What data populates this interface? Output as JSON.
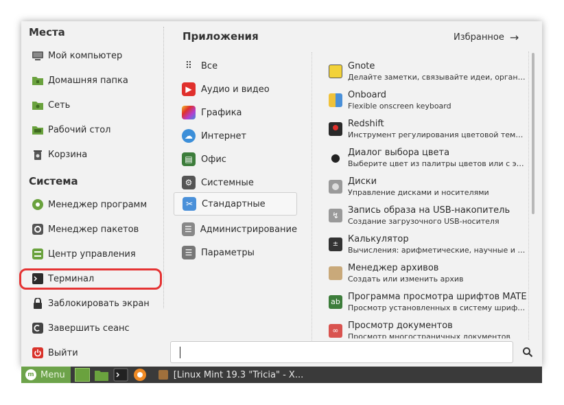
{
  "places": {
    "title": "Места",
    "items": [
      {
        "label": "Мой компьютер",
        "icon": "computer-icon"
      },
      {
        "label": "Домашняя папка",
        "icon": "home-folder-icon"
      },
      {
        "label": "Сеть",
        "icon": "network-folder-icon"
      },
      {
        "label": "Рабочий стол",
        "icon": "desktop-folder-icon"
      },
      {
        "label": "Корзина",
        "icon": "trash-icon"
      }
    ]
  },
  "system": {
    "title": "Система",
    "items": [
      {
        "label": "Менеджер программ",
        "icon": "software-manager-icon"
      },
      {
        "label": "Менеджер пакетов",
        "icon": "package-manager-icon"
      },
      {
        "label": "Центр управления",
        "icon": "control-center-icon"
      },
      {
        "label": "Терминал",
        "icon": "terminal-icon"
      },
      {
        "label": "Заблокировать экран",
        "icon": "lock-icon"
      },
      {
        "label": "Завершить сеанс",
        "icon": "logout-icon"
      },
      {
        "label": "Выйти",
        "icon": "power-icon"
      }
    ]
  },
  "apps": {
    "title": "Приложения",
    "favorites_label": "Избранное",
    "categories": [
      {
        "label": "Все",
        "color": "#444444"
      },
      {
        "label": "Аудио и видео",
        "color": "#e0302c"
      },
      {
        "label": "Графика",
        "color": "#d64a9b"
      },
      {
        "label": "Интернет",
        "color": "#3c8fd9"
      },
      {
        "label": "Офис",
        "color": "#3d7d3b"
      },
      {
        "label": "Системные",
        "color": "#555555"
      },
      {
        "label": "Стандартные",
        "color": "#4a90d9"
      },
      {
        "label": "Администрирование",
        "color": "#888888"
      },
      {
        "label": "Параметры",
        "color": "#777777"
      }
    ],
    "selected_category": "Стандартные",
    "list": [
      {
        "name": "Gnote",
        "desc": "Делайте заметки, связывайте идеи, организуйте",
        "color": "#f2d23a"
      },
      {
        "name": "Onboard",
        "desc": "Flexible onscreen keyboard",
        "color": "#f0c23a"
      },
      {
        "name": "Redshift",
        "desc": "Инструмент регулирования цветовой температуры",
        "color": "#2a2a2a"
      },
      {
        "name": "Диалог выбора цвета",
        "desc": "Выберите цвет из палитры цветов или с экрана",
        "color": "#222222"
      },
      {
        "name": "Диски",
        "desc": "Управление дисками и носителями",
        "color": "#9a9a9a"
      },
      {
        "name": "Запись образа на USB-накопитель",
        "desc": "Создание загрузочного USB-носителя",
        "color": "#9a9a9a"
      },
      {
        "name": "Калькулятор",
        "desc": "Вычисления: арифметические, научные и финансовые",
        "color": "#333333"
      },
      {
        "name": "Менеджер архивов",
        "desc": "Создать или изменить архив",
        "color": "#c9a97a"
      },
      {
        "name": "Программа просмотра шрифтов MATE",
        "desc": "Просмотр установленных в систему шрифтов",
        "color": "#3d7d3b"
      },
      {
        "name": "Просмотр документов",
        "desc": "Просмотр многостраничных документов",
        "color": "#d9534f"
      }
    ]
  },
  "taskbar": {
    "menu_label": "Menu",
    "window_title": "[Linux Mint 19.3 \"Tricia\" - X..."
  }
}
